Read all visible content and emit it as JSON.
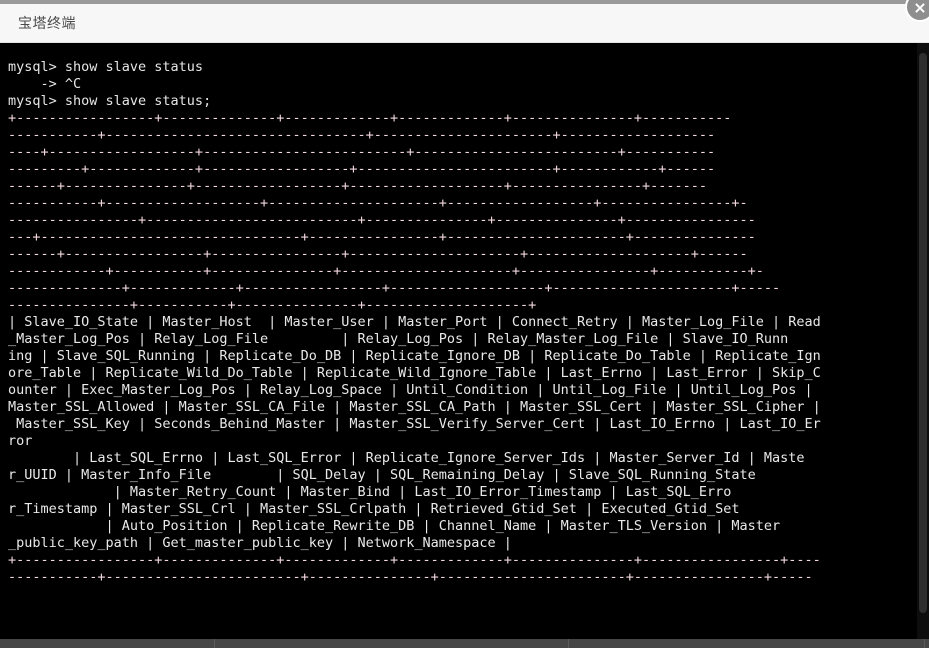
{
  "window": {
    "title": "宝塔终端",
    "close_icon": "close-icon"
  },
  "colors": {
    "titlebar_bg": "#f7f7f7",
    "terminal_bg": "#000000",
    "terminal_fg": "#d8d8d8",
    "separator_fg": "#f2d7dd",
    "close_button_bg": "#8e8e8e",
    "scrollbar_thumb": "#2e2e2e"
  },
  "terminal": {
    "lines": [
      {
        "type": "prompt",
        "text": "mysql> show slave status"
      },
      {
        "type": "prompt",
        "text": "    -> ^C"
      },
      {
        "type": "prompt",
        "text": "mysql> show slave status;"
      },
      {
        "type": "sep",
        "text": "+-----------------+--------------+-------------+-------------+---------------+-----------"
      },
      {
        "type": "sep",
        "text": "-----------+--------------------------------+----------------------+-------------------"
      },
      {
        "type": "sep",
        "text": "----+------------------+-------------------------+-------------------------+-----------"
      },
      {
        "type": "sep",
        "text": "---------+-------------+------------------+------------------------+------------+------"
      },
      {
        "type": "sep",
        "text": "------+---------------+------------------+-------------------+----------------+-------"
      },
      {
        "type": "sep",
        "text": "-----------+-------------------+---------------------+------------------+----------------+-"
      },
      {
        "type": "sep",
        "text": "----------------+--------------------------+---------------+---------------+----------------"
      },
      {
        "type": "sep",
        "text": "---+--------------------------------+----------------+----------------------+---------------"
      },
      {
        "type": "sep",
        "text": "------+-----------------+----------------+---------------------+--------------------+------"
      },
      {
        "type": "sep",
        "text": "------------+-----------+---------------+---------------------+----------------+-----------+-"
      },
      {
        "type": "sep",
        "text": "--------------+-------------+-----------------+-------------------+----------------------+-----"
      },
      {
        "type": "sep",
        "text": "---------------+-----------+---------------+--------------------+"
      },
      {
        "type": "header",
        "text": "| Slave_IO_State | Master_Host  | Master_User | Master_Port | Connect_Retry | Master_Log_File | Read"
      },
      {
        "type": "header",
        "text": "_Master_Log_Pos | Relay_Log_File         | Relay_Log_Pos | Relay_Master_Log_File | Slave_IO_Runn"
      },
      {
        "type": "header",
        "text": "ing | Slave_SQL_Running | Replicate_Do_DB | Replicate_Ignore_DB | Replicate_Do_Table | Replicate_Ign"
      },
      {
        "type": "header",
        "text": "ore_Table | Replicate_Wild_Do_Table | Replicate_Wild_Ignore_Table | Last_Errno | Last_Error | Skip_C"
      },
      {
        "type": "header",
        "text": "ounter | Exec_Master_Log_Pos | Relay_Log_Space | Until_Condition | Until_Log_File | Until_Log_Pos |"
      },
      {
        "type": "header",
        "text": "Master_SSL_Allowed | Master_SSL_CA_File | Master_SSL_CA_Path | Master_SSL_Cert | Master_SSL_Cipher |"
      },
      {
        "type": "header",
        "text": " Master_SSL_Key | Seconds_Behind_Master | Master_SSL_Verify_Server_Cert | Last_IO_Errno | Last_IO_Er"
      },
      {
        "type": "header",
        "text": "ror"
      },
      {
        "type": "header",
        "text": "        | Last_SQL_Errno | Last_SQL_Error | Replicate_Ignore_Server_Ids | Master_Server_Id | Maste"
      },
      {
        "type": "header",
        "text": "r_UUID | Master_Info_File        | SQL_Delay | SQL_Remaining_Delay | Slave_SQL_Running_State"
      },
      {
        "type": "header",
        "text": "             | Master_Retry_Count | Master_Bind | Last_IO_Error_Timestamp | Last_SQL_Erro"
      },
      {
        "type": "header",
        "text": "r_Timestamp | Master_SSL_Crl | Master_SSL_Crlpath | Retrieved_Gtid_Set | Executed_Gtid_Set"
      },
      {
        "type": "header",
        "text": "            | Auto_Position | Replicate_Rewrite_DB | Channel_Name | Master_TLS_Version | Master"
      },
      {
        "type": "header",
        "text": "_public_key_path | Get_master_public_key | Network_Namespace |"
      },
      {
        "type": "sep",
        "text": "+-----------------+--------------+-------------+-------------+---------------+-----------------+----"
      },
      {
        "type": "sep",
        "text": "-----------+------------------------+---------------+-----------------------+----------------+-----"
      }
    ]
  },
  "scrollbars": {
    "vertical_name": "vertical-scrollbar",
    "horizontal_name": "horizontal-scrollbar"
  }
}
